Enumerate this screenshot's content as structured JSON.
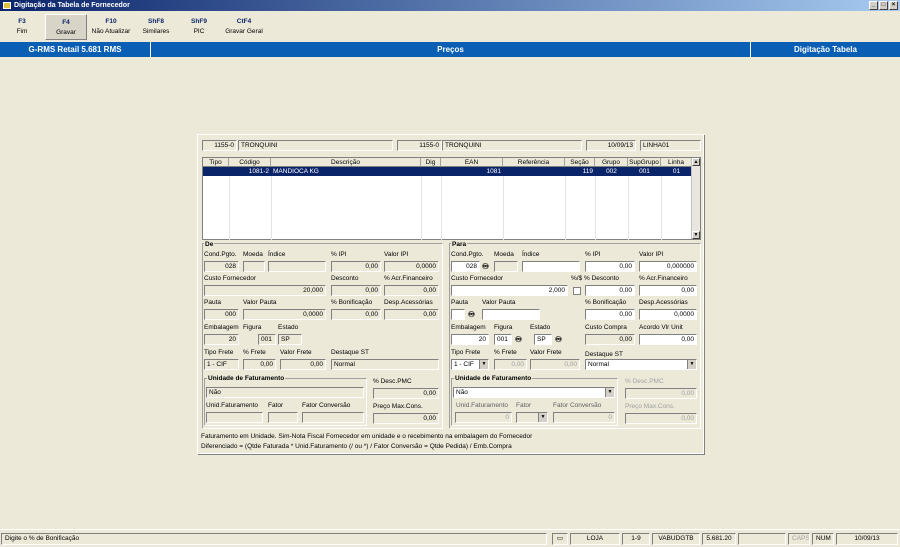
{
  "window": {
    "title": "Digitação da Tabela de Fornecedor",
    "min": "_",
    "max": "□",
    "close": "×"
  },
  "toolbar": [
    {
      "key": "F3",
      "label": "Fim"
    },
    {
      "key": "F4",
      "label": "Gravar"
    },
    {
      "key": "F10",
      "label": "Não Atualizar"
    },
    {
      "key": "ShF8",
      "label": "Similares"
    },
    {
      "key": "ShF9",
      "label": "PIC"
    },
    {
      "key": "CtF4",
      "label": "Gravar Geral"
    }
  ],
  "band": {
    "left": "G-RMS Retail 5.681 RMS",
    "center": "Preços",
    "right": "Digitação Tabela"
  },
  "header": {
    "code1": "1155-0",
    "name1": "TRONQUINI",
    "code2": "1155-0",
    "name2": "TRONQUINI",
    "date": "10/09/13",
    "line": "LINHA01"
  },
  "grid": {
    "columns": [
      "Tipo",
      "Código",
      "Descrição",
      "Dig",
      "EAN",
      "Referência",
      "Seção",
      "Grupo",
      "SupGrupo",
      "Linha"
    ],
    "rows": [
      {
        "tipo": "",
        "codigo": "1081-2",
        "descricao": "MANDIOCA KG",
        "dig": "",
        "ean": "1081",
        "referencia": "",
        "secao": "119",
        "grupo": "002",
        "supgrupo": "001",
        "linha": "01"
      }
    ]
  },
  "de": {
    "title": "De",
    "cond_label": "Cond.Pgto.",
    "moeda_label": "Moeda",
    "indice_label": "Índice",
    "ipi_label": "% IPI",
    "valoripi_label": "Valor IPI",
    "cond": "028",
    "moeda": "",
    "indice": "",
    "ipi": "0,00",
    "valoripi": "0,0000",
    "custo_label": "Custo Fornecedor",
    "desconto_label": "Desconto",
    "acr_label": "% Acr.Financeiro",
    "custo": "20,000",
    "desconto": "0,00",
    "acr": "0,00",
    "pauta_label": "Pauta",
    "valorpauta_label": "Valor Pauta",
    "bonif_label": "% Bonificação",
    "desp_label": "Desp.Acessórias",
    "pauta": "000",
    "valorpauta": "0,0000",
    "bonif": "0,00",
    "desp": "0,00",
    "emb_label": "Embalagem",
    "figura_label": "Figura",
    "estado_label": "Estado",
    "emb": "20",
    "figura": "001",
    "estado": "SP",
    "tipofrete_label": "Tipo Frete",
    "pfrete_label": "% Frete",
    "valorfrete_label": "Valor Frete",
    "destaque_label": "Destaque ST",
    "tipofrete": "1 - CIF",
    "pfrete": "0,00",
    "valorfrete": "0,00",
    "destaque": "Normal",
    "unid_title": "Unidade de Faturamento",
    "unid": "Não",
    "descpmc_label": "% Desc.PMC",
    "descpmc": "0,00",
    "unidfat_label": "Unid.Faturamento",
    "fator_label": "Fator",
    "fatorconv_label": "Fator Conversão",
    "precomax_label": "Preço Max.Cons.",
    "unidfat": "",
    "fator": "",
    "fatorconv": "",
    "precomax": "0,00"
  },
  "para": {
    "title": "Para",
    "cond_label": "Cond.Pgto.",
    "moeda_label": "Moeda",
    "indice_label": "Índice",
    "ipi_label": "% IPI",
    "valoripi_label": "Valor IPI",
    "cond": "028",
    "moeda": "",
    "indice": "",
    "ipi": "0,00",
    "valoripi": "0,000000",
    "custo_label": "Custo Fornecedor",
    "desconto_label": "%/$ % Desconto",
    "acr_label": "% Acr.Financeiro",
    "custo": "2,000",
    "desconto": "0,00",
    "acr": "0,00",
    "pauta_label": "Pauta",
    "valorpauta_label": "Valor Pauta",
    "bonif_label": "% Bonificação",
    "desp_label": "Desp.Acessórias",
    "pauta": "",
    "valorpauta": "",
    "bonif": "0,00",
    "desp": "0,0000",
    "emb_label": "Embalagem",
    "figura_label": "Figura",
    "estado_label": "Estado",
    "custocompra_label": "Custo Compra",
    "acordo_label": "Acordo Vlr Unit",
    "emb": "20",
    "figura": "001",
    "estado": "SP",
    "custocompra": "0,00",
    "acordo": "0,00",
    "tipofrete_label": "Tipo Frete",
    "pfrete_label": "% Frete",
    "valorfrete_label": "Valor Frete",
    "destaque_label": "Destaque ST",
    "tipofrete": "1 - CIF",
    "pfrete": "0,00",
    "valorfrete": "0,00",
    "destaque": "Normal",
    "unid_title": "Unidade de Faturamento",
    "unid": "Não",
    "descpmc_label": "% Desc.PMC",
    "descpmc": "0,00",
    "unidfat_label": "Unid.Faturamento",
    "fator_label": "Fator",
    "fatorconv_label": "Fator Conversão",
    "precomax_label": "Preço Max.Cons.",
    "unidfat": "0",
    "fator": "",
    "fatorconv": "0",
    "precomax": "0,00"
  },
  "notes": [
    "Faturamento em Unidade. Sim-Nota Fiscal Fornecedor em unidade e o recebimento na embalagem do Fornecedor",
    "Diferenciado = (Qtde Faturada * Unid.Faturamento (/ ou *) / Fator Conversão = Qtde Pedida) / Emb.Compra"
  ],
  "status": {
    "hint": "Digite o % de Bonificação",
    "store": "LOJA",
    "range": "1-9",
    "db": "VABUDGTB",
    "version": "5.681.20",
    "caps": "CAPS",
    "num": "NUM",
    "date": "10/09/13"
  }
}
